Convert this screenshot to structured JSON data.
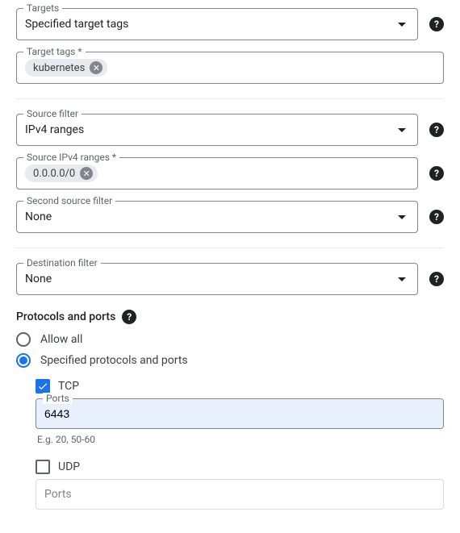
{
  "targets": {
    "legend": "Targets",
    "value": "Specified target tags"
  },
  "targetTags": {
    "legend": "Target tags *",
    "chip": "kubernetes"
  },
  "sourceFilter": {
    "legend": "Source filter",
    "value": "IPv4 ranges"
  },
  "sourceRanges": {
    "legend": "Source IPv4 ranges *",
    "chip": "0.0.0.0/0"
  },
  "secondSourceFilter": {
    "legend": "Second source filter",
    "value": "None"
  },
  "destinationFilter": {
    "legend": "Destination filter",
    "value": "None"
  },
  "protocolsSection": {
    "title": "Protocols and ports",
    "allowAll": "Allow all",
    "specified": "Specified protocols and ports"
  },
  "tcp": {
    "label": "TCP",
    "portsLegend": "Ports",
    "portsValue": "6443",
    "hint": "E.g. 20, 50-60"
  },
  "udp": {
    "label": "UDP",
    "portsPlaceholder": "Ports"
  }
}
